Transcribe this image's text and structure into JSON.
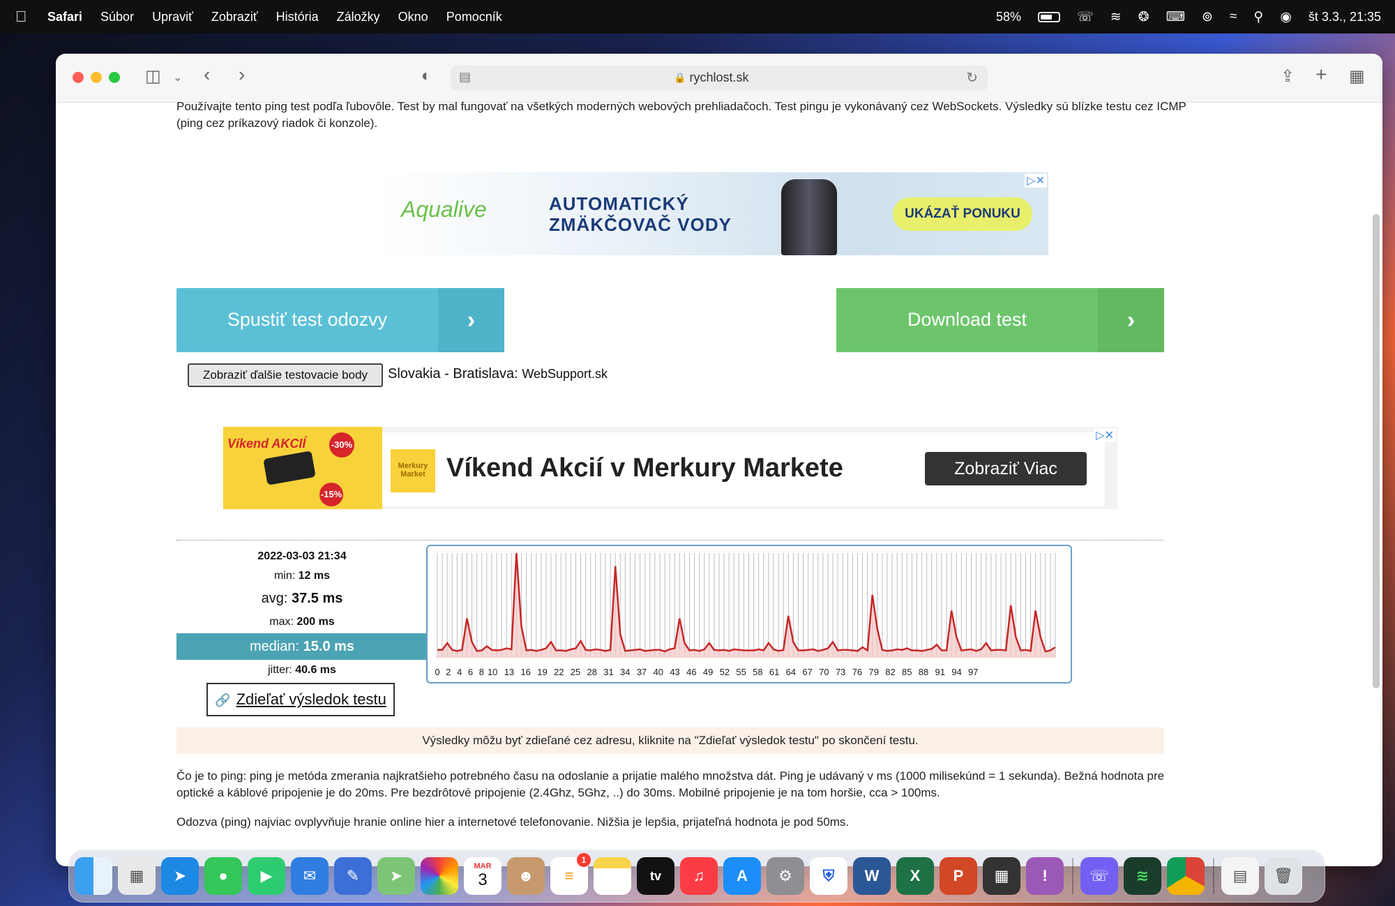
{
  "menubar": {
    "app": "Safari",
    "items": [
      "Súbor",
      "Upraviť",
      "Zobraziť",
      "História",
      "Záložky",
      "Okno",
      "Pomocník"
    ],
    "battery": "58%",
    "datetime": "št 3.3.,  21:35"
  },
  "browser": {
    "url": "rychlost.sk"
  },
  "page": {
    "intro": "Používajte tento ping test podľa ľubovôle. Test by mal fungovať na všetkých moderných webových prehliadačoch. Test pingu je vykonávaný cez WebSockets. Výsledky sú blízke testu cez ICMP (ping cez príkazový riadok či konzole).",
    "ad1": {
      "brand": "Aqualive",
      "headline_1": "AUTOMATICKÝ",
      "headline_2": "ZMÄKČOVAČ VODY",
      "cta": "UKÁZAŤ PONUKU"
    },
    "ping_button": "Spustiť test odozvy",
    "download_button": "Download test",
    "server_button": "Zobraziť ďalšie testovacie body",
    "server_location": "Slovakia - Bratislava:",
    "server_host": "WebSupport.sk",
    "ad2": {
      "promo_title": "Víkend AKCIÍ",
      "badge_1": "-30%",
      "badge_2": "-15%",
      "logo": "Merkury Market",
      "headline": "Víkend Akcií v Merkury Markete",
      "cta": "Zobraziť Viac"
    },
    "results": {
      "date": "2022-03-03 21:34",
      "min_label": "min:",
      "min": "12 ms",
      "avg_label": "avg:",
      "avg": "37.5 ms",
      "max_label": "max:",
      "max": "200 ms",
      "median_label": "median:",
      "median": "15.0 ms",
      "jitter_label": "jitter:",
      "jitter": "40.6 ms"
    },
    "share_button": "Zdieľať výsledok testu",
    "notice": "Výsledky môžu byť zdieľané cez adresu, kliknite na \"Zdieľať výsledok testu\" po skončení testu.",
    "paragraph_1": "Čo je to ping: ping je metóda zmerania najkratšieho potrebného času na odoslanie a prijatie malého množstva dát. Ping je udávaný v ms (1000 milisekúnd = 1 sekunda). Bežná hodnota pre optické a káblové pripojenie je do 20ms. Pre bezdrôtové pripojenie (2.4Ghz, 5Ghz, ..) do 30ms. Mobilné pripojenie je na tom horšie, cca > 100ms.",
    "paragraph_2": "Odozva (ping) najviac ovplyvňuje hranie online hier a internetové telefonovanie. Nižšia je lepšia, prijateľná hodnota je pod 50ms."
  },
  "chart_data": {
    "type": "line",
    "x_tick_labels": [
      "0",
      "2",
      "4",
      "6",
      "8",
      "10",
      "13",
      "16",
      "19",
      "22",
      "25",
      "28",
      "31",
      "34",
      "37",
      "40",
      "43",
      "46",
      "49",
      "52",
      "55",
      "58",
      "61",
      "64",
      "67",
      "70",
      "73",
      "76",
      "79",
      "82",
      "85",
      "88",
      "91",
      "94",
      "97"
    ],
    "x_range": [
      0,
      99
    ],
    "ylim": [
      0,
      200
    ],
    "color": "#c62828",
    "fill": "#f5c6c6",
    "values": [
      15,
      15,
      28,
      15,
      13,
      15,
      75,
      30,
      13,
      14,
      22,
      15,
      14,
      15,
      18,
      16,
      200,
      60,
      14,
      15,
      13,
      15,
      18,
      30,
      14,
      14,
      13,
      16,
      18,
      32,
      15,
      14,
      16,
      15,
      13,
      15,
      175,
      45,
      13,
      14,
      15,
      16,
      13,
      14,
      15,
      15,
      12,
      16,
      18,
      75,
      28,
      14,
      15,
      13,
      16,
      28,
      15,
      14,
      15,
      13,
      16,
      15,
      14,
      14,
      14,
      16,
      14,
      28,
      16,
      13,
      15,
      80,
      30,
      14,
      14,
      15,
      16,
      13,
      15,
      18,
      30,
      14,
      15,
      15,
      14,
      13,
      20,
      14,
      120,
      55,
      15,
      13,
      14,
      16,
      15,
      18,
      14,
      14,
      13,
      15,
      17,
      25,
      14,
      14,
      90,
      40,
      14,
      15,
      16,
      13,
      16,
      28,
      14,
      15,
      15,
      14,
      100,
      40,
      14,
      15,
      13,
      90,
      40,
      12,
      14,
      20
    ]
  },
  "dock": {
    "apps": [
      "finder",
      "launchpad",
      "safari",
      "messages",
      "facetime",
      "mail",
      "textedit",
      "maps",
      "photos",
      "calendar",
      "contacts",
      "reminders",
      "notes",
      "tv",
      "music",
      "app-store",
      "system-preferences",
      "adguard",
      "word",
      "excel",
      "powerpoint",
      "activity-monitor",
      "feedback",
      "viber",
      "audio-app",
      "chrome",
      "documents",
      "trash"
    ],
    "calendar_month": "MAR",
    "calendar_day": "3",
    "reminders_badge": "1",
    "tv_label": "tv"
  }
}
